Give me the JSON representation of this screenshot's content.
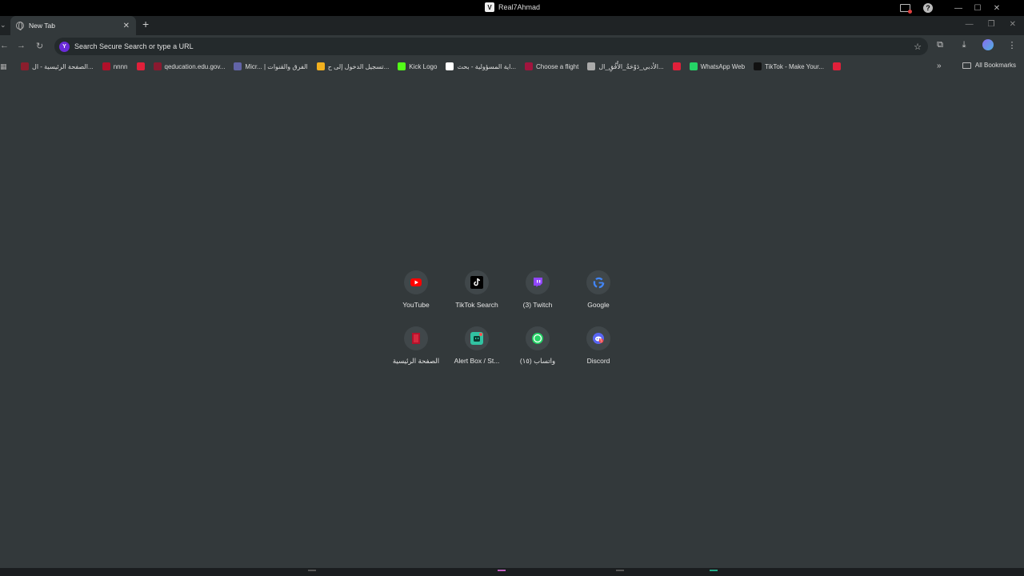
{
  "os": {
    "window_title": "Real7Ahmad"
  },
  "tab": {
    "title": "New Tab",
    "close": "✕",
    "new": "+"
  },
  "omnibox": {
    "placeholder": "Search Secure Search or type a URL"
  },
  "bookmarks": {
    "items": [
      {
        "label": "الصفحة الرئيسية - ال...",
        "color": "#8b1e2d"
      },
      {
        "label": "nnnn",
        "color": "#b0102a"
      },
      {
        "label": "",
        "color": "#e0203a"
      },
      {
        "label": "qeducation.edu.gov...",
        "color": "#8a1a30"
      },
      {
        "label": "Micr... | الفرق والقنوات",
        "color": "#6264a7"
      },
      {
        "label": "تسجيل الدخول إلى ح...",
        "color": "#f2b01e"
      },
      {
        "label": "Kick Logo",
        "color": "#53fc18"
      },
      {
        "label": "اية المسؤولية - بحث...",
        "color": "#ffffff"
      },
      {
        "label": "Choose a flight",
        "color": "#a0153e"
      },
      {
        "label": "الأدبي_دَوْحَةُ_الأُفُقِ_ال...",
        "color": "#aaaaaa"
      },
      {
        "label": "",
        "color": "#e0203a"
      },
      {
        "label": "WhatsApp Web",
        "color": "#25d366"
      },
      {
        "label": "TikTok - Make Your...",
        "color": "#111111"
      },
      {
        "label": "",
        "color": "#e0203a"
      }
    ],
    "more": "»",
    "all_label": "All Bookmarks"
  },
  "shortcuts": [
    {
      "label": "YouTube",
      "icon": "youtube-icon"
    },
    {
      "label": "TikTok Search",
      "icon": "tiktok-icon"
    },
    {
      "label": "(3) Twitch",
      "icon": "twitch-icon"
    },
    {
      "label": "Google",
      "icon": "google-icon"
    },
    {
      "label": "الصفحة الرئيسية",
      "icon": "home-page-icon"
    },
    {
      "label": "Alert Box / St...",
      "icon": "streamlabs-icon"
    },
    {
      "label": "(١٥) واتساب",
      "icon": "whatsapp-icon"
    },
    {
      "label": "Discord",
      "icon": "discord-icon"
    }
  ]
}
